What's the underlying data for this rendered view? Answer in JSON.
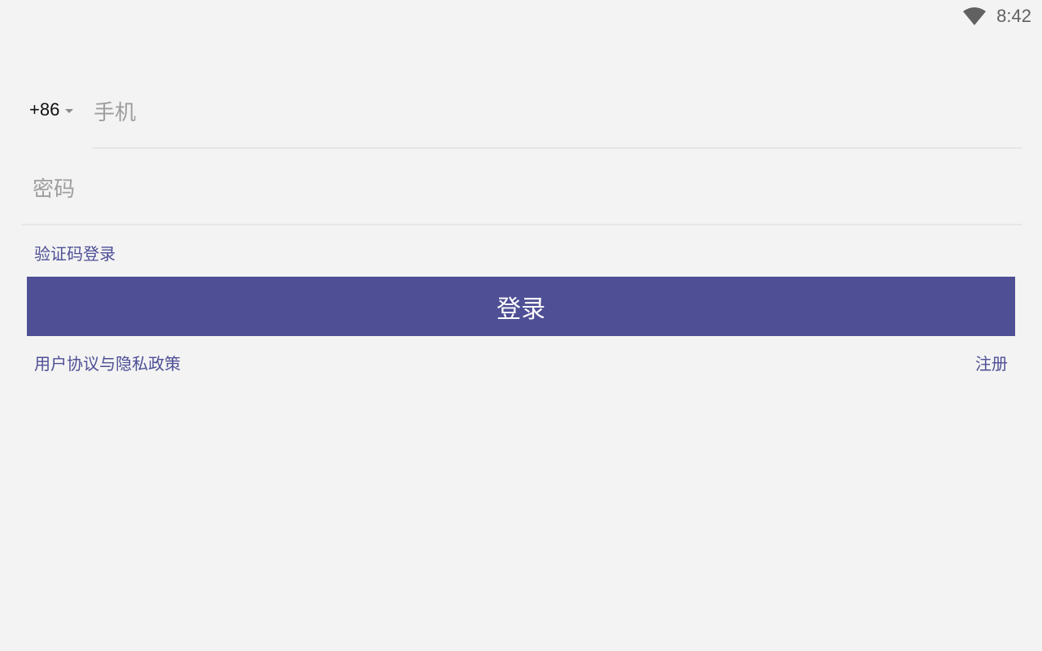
{
  "status_bar": {
    "time": "8:42",
    "wifi_icon": "wifi-icon"
  },
  "login_form": {
    "country_code": "+86",
    "phone_placeholder": "手机",
    "phone_value": "",
    "password_placeholder": "密码",
    "password_value": "",
    "sms_login_label": "验证码登录",
    "login_button_label": "登录",
    "agreement_label": "用户协议与隐私政策",
    "register_label": "注册"
  },
  "colors": {
    "background": "#f3f3f3",
    "accent": "#4f4f96",
    "link": "#4e4f96",
    "placeholder": "#9e9e9e",
    "divider": "#e6e6e6"
  }
}
